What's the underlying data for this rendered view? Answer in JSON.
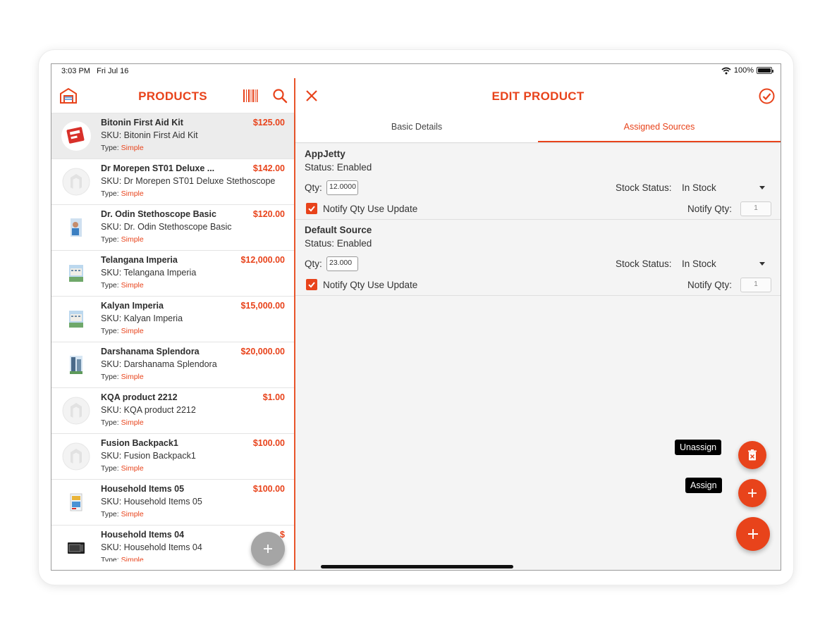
{
  "status_bar": {
    "time": "3:03 PM",
    "date": "Fri Jul 16",
    "battery": "100%"
  },
  "products_panel": {
    "title": "PRODUCTS",
    "items": [
      {
        "name": "Bitonin First Aid Kit",
        "price": "$125.00",
        "sku": "SKU: Bitonin First Aid Kit",
        "type_label": "Type:",
        "type": "Simple",
        "thumb": "kit"
      },
      {
        "name": "Dr Morepen ST01 Deluxe ...",
        "price": "$142.00",
        "sku": "SKU: Dr Morepen ST01 Deluxe Stethoscope",
        "type_label": "Type:",
        "type": "Simple",
        "thumb": "placeholder"
      },
      {
        "name": "Dr. Odin Stethoscope Basic",
        "price": "$120.00",
        "sku": "SKU: Dr. Odin Stethoscope Basic",
        "type_label": "Type:",
        "type": "Simple",
        "thumb": "photo"
      },
      {
        "name": "Telangana Imperia",
        "price": "$12,000.00",
        "sku": "SKU: Telangana Imperia",
        "type_label": "Type:",
        "type": "Simple",
        "thumb": "building"
      },
      {
        "name": "Kalyan Imperia",
        "price": "$15,000.00",
        "sku": "SKU: Kalyan Imperia",
        "type_label": "Type:",
        "type": "Simple",
        "thumb": "building"
      },
      {
        "name": "Darshanama Splendora",
        "price": "$20,000.00",
        "sku": "SKU: Darshanama Splendora",
        "type_label": "Type:",
        "type": "Simple",
        "thumb": "tower"
      },
      {
        "name": "KQA product 2212",
        "price": "$1.00",
        "sku": "SKU: KQA product 2212",
        "type_label": "Type:",
        "type": "Simple",
        "thumb": "placeholder"
      },
      {
        "name": "Fusion Backpack1",
        "price": "$100.00",
        "sku": "SKU: Fusion Backpack1",
        "type_label": "Type:",
        "type": "Simple",
        "thumb": "placeholder"
      },
      {
        "name": "Household Items 05",
        "price": "$100.00",
        "sku": "SKU: Household Items 05",
        "type_label": "Type:",
        "type": "Simple",
        "thumb": "box"
      },
      {
        "name": "Household Items 04",
        "price": "$",
        "sku": "SKU: Household Items 04",
        "type_label": "Type:",
        "type": "Simple",
        "thumb": "oven"
      }
    ]
  },
  "edit_panel": {
    "title": "EDIT PRODUCT",
    "tabs": [
      {
        "label": "Basic Details",
        "active": false
      },
      {
        "label": "Assigned Sources",
        "active": true
      }
    ],
    "sources": [
      {
        "name": "AppJetty",
        "status": "Status: Enabled",
        "qty_label": "Qty:",
        "qty_value": "12.0000",
        "stock_label": "Stock Status:",
        "stock_value": "In Stock",
        "notify_label": "Notify Qty Use Update",
        "notify_checked": true,
        "notify_qty_label": "Notify Qty:",
        "notify_qty_value": "1"
      },
      {
        "name": "Default Source",
        "status": "Status: Enabled",
        "qty_label": "Qty:",
        "qty_value": "23.000",
        "stock_label": "Stock Status:",
        "stock_value": "In Stock",
        "notify_label": "Notify Qty Use Update",
        "notify_checked": true,
        "notify_qty_label": "Notify Qty:",
        "notify_qty_value": "1"
      }
    ],
    "actions": {
      "unassign_label": "Unassign",
      "assign_label": "Assign"
    }
  },
  "colors": {
    "accent": "#e8431b",
    "fab_gray": "#a5a5a5",
    "selected_row": "#ececec",
    "panel_bg": "#f4f4f4"
  }
}
